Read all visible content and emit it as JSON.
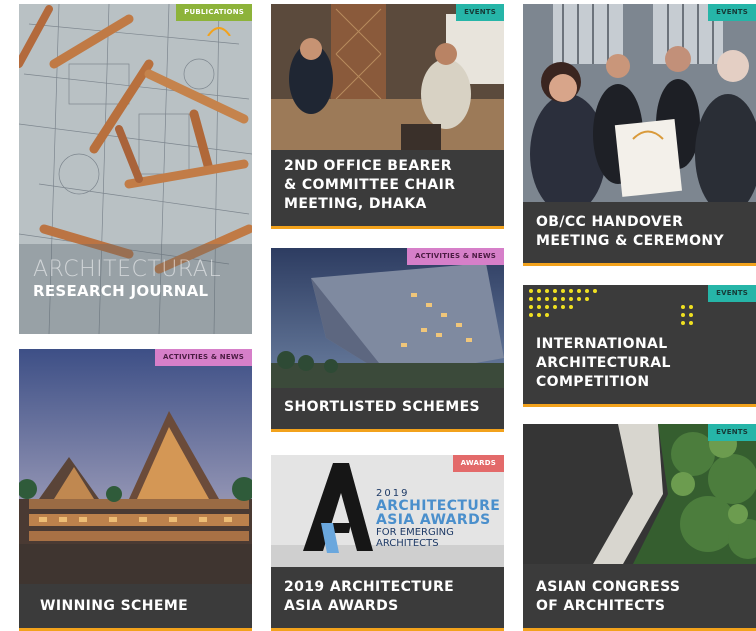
{
  "cards": {
    "journal": {
      "tag": "PUBLICATIONS",
      "title_line1": "ARCHITECTURAL",
      "title_line2": "RESEARCH JOURNAL"
    },
    "dhaka": {
      "tag": "EVENTS",
      "caption": "2ND OFFICE BEARER\n& COMMITTEE CHAIR\nMEETING, DHAKA"
    },
    "handover": {
      "tag": "EVENTS",
      "caption": "OB/CC HANDOVER\nMEETING & CEREMONY"
    },
    "shortlisted": {
      "tag": "ACTIVITIES & NEWS",
      "caption": "SHORTLISTED SCHEMES"
    },
    "competition": {
      "tag": "EVENTS",
      "caption": "INTERNATIONAL\nARCHITECTURAL\nCOMPETITION"
    },
    "winning": {
      "tag": "ACTIVITIES & NEWS",
      "caption": "WINNING SCHEME"
    },
    "awards": {
      "tag": "AWARDS",
      "caption": "2019 ARCHITECTURE\nASIA AWARDS",
      "logo_year": "2019",
      "logo_line1": "ARCHITECTURE",
      "logo_line2": "ASIA AWARDS",
      "logo_line3": "FOR EMERGING",
      "logo_line4": "ARCHITECTS"
    },
    "congress": {
      "tag": "EVENTS",
      "caption": "ASIAN CONGRESS\nOF ARCHITECTS"
    }
  }
}
